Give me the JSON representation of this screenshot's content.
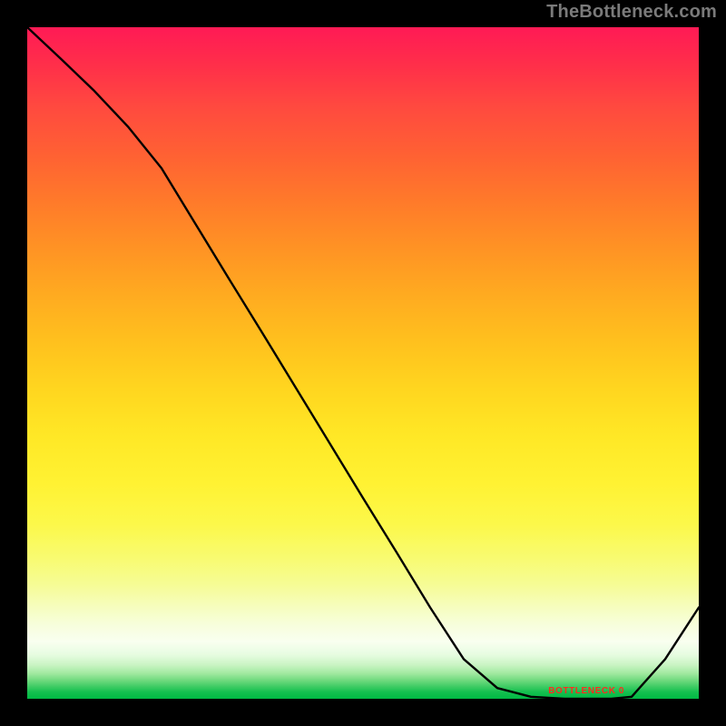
{
  "attribution": "TheBottleneck.com",
  "baseline_label": "BOTTLENECK 0",
  "colors": {
    "frame": "#000000",
    "attribution_text": "#7a7a7a",
    "baseline_text": "#ff2b1f",
    "curve": "#000000",
    "gradient_top": "#ff1a55",
    "gradient_bottom": "#00b944"
  },
  "chart_data": {
    "type": "line",
    "title": "",
    "xlabel": "",
    "ylabel": "",
    "x_range": [
      0,
      100
    ],
    "y_range": [
      0,
      100
    ],
    "x": [
      0,
      5,
      10,
      15,
      20,
      25,
      30,
      35,
      40,
      45,
      50,
      55,
      60,
      65,
      70,
      75,
      80,
      82,
      85,
      87,
      90,
      95,
      100
    ],
    "values": [
      100,
      95.3,
      90.5,
      85.2,
      79.0,
      70.8,
      62.6,
      54.5,
      46.3,
      38.1,
      29.9,
      21.8,
      13.6,
      5.9,
      1.6,
      0.3,
      0.0,
      0.0,
      0.0,
      0.0,
      0.3,
      5.9,
      13.6
    ],
    "annotations": [
      {
        "text": "BOTTLENECK 0",
        "x": 83,
        "y": 0.6
      }
    ],
    "notes": "Values 0–100 scale; 0 at bottom (green), 100 at top (red). Dip reaches ~0 between x≈75 and x≈88."
  }
}
